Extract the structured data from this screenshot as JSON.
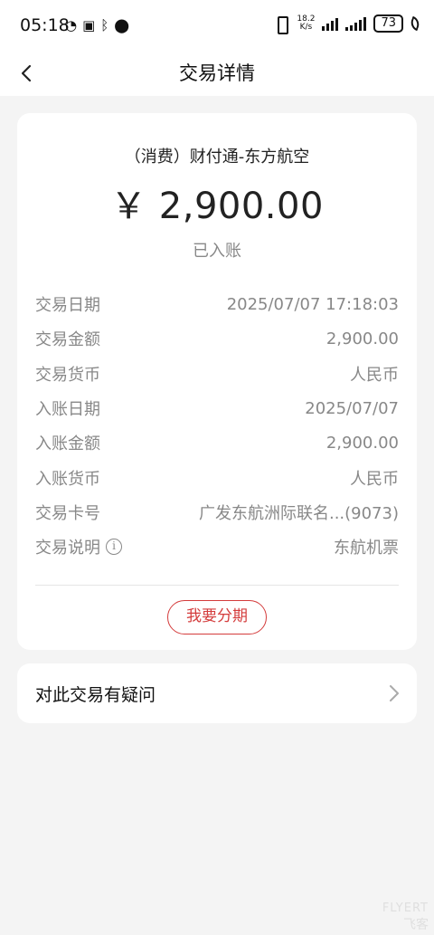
{
  "status_bar": {
    "time": "05:18",
    "left_icons": [
      "hd-call-icon",
      "nfc-icon",
      "bluetooth-icon",
      "location-icon"
    ],
    "net_speed_value": "18.2",
    "net_speed_unit": "K/s",
    "battery": "73"
  },
  "nav": {
    "title": "交易详情"
  },
  "summary": {
    "merchant": "（消费）财付通-东方航空",
    "amount": "￥ 2,900.00",
    "status": "已入账"
  },
  "details": [
    {
      "label": "交易日期",
      "value": "2025/07/07 17:18:03"
    },
    {
      "label": "交易金额",
      "value": "2,900.00"
    },
    {
      "label": "交易货币",
      "value": "人民币"
    },
    {
      "label": "入账日期",
      "value": "2025/07/07"
    },
    {
      "label": "入账金额",
      "value": "2,900.00"
    },
    {
      "label": "入账货币",
      "value": "人民币"
    },
    {
      "label": "交易卡号",
      "value": "广发东航洲际联名...(9073)"
    },
    {
      "label": "交易说明",
      "value": "东航机票"
    }
  ],
  "install_button": "我要分期",
  "question_row": "对此交易有疑问",
  "watermark": {
    "top": "FLYERT",
    "bottom": "飞客"
  },
  "colors": {
    "accent": "#d43c3c",
    "background": "#f4f4f4",
    "muted_text": "#888888"
  }
}
